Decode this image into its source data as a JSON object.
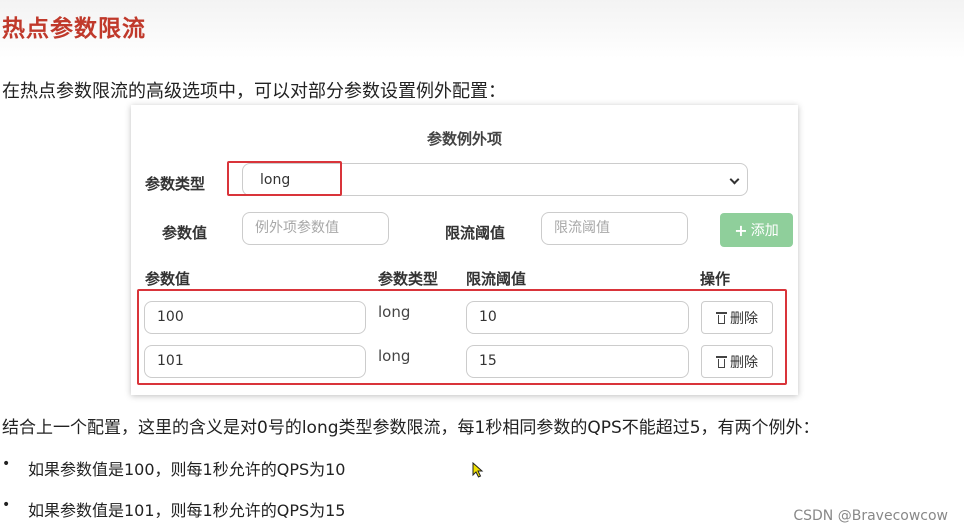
{
  "page": {
    "title": "热点参数限流",
    "intro": "在热点参数限流的高级选项中，可以对部分参数设置例外配置："
  },
  "panel": {
    "title": "参数例外项",
    "param_type_label": "参数类型",
    "param_type_value": "long",
    "param_value_label": "参数值",
    "param_value_placeholder": "例外项参数值",
    "threshold_label": "限流阈值",
    "threshold_placeholder": "限流阈值",
    "add_button": "添加",
    "table": {
      "headers": [
        "参数值",
        "参数类型",
        "限流阈值",
        "操作"
      ],
      "rows": [
        {
          "value": "100",
          "type": "long",
          "threshold": "10",
          "action": "删除"
        },
        {
          "value": "101",
          "type": "long",
          "threshold": "15",
          "action": "删除"
        }
      ]
    }
  },
  "explanation": {
    "summary": "结合上一个配置，这里的含义是对0号的long类型参数限流，每1秒相同参数的QPS不能超过5，有两个例外：",
    "bullets": [
      "如果参数值是100，则每1秒允许的QPS为10",
      "如果参数值是101，则每1秒允许的QPS为15"
    ],
    "bullet_mark": "•"
  },
  "watermark": "CSDN @Bravecowcow",
  "colors": {
    "title_red": "#c0392b",
    "highlight_red": "#d9343a",
    "add_button_green": "#8fcf9b"
  },
  "icons": {
    "add": "plus-icon",
    "delete": "trash-icon",
    "select": "chevron-down-icon",
    "pointer": "mouse-cursor-icon"
  }
}
